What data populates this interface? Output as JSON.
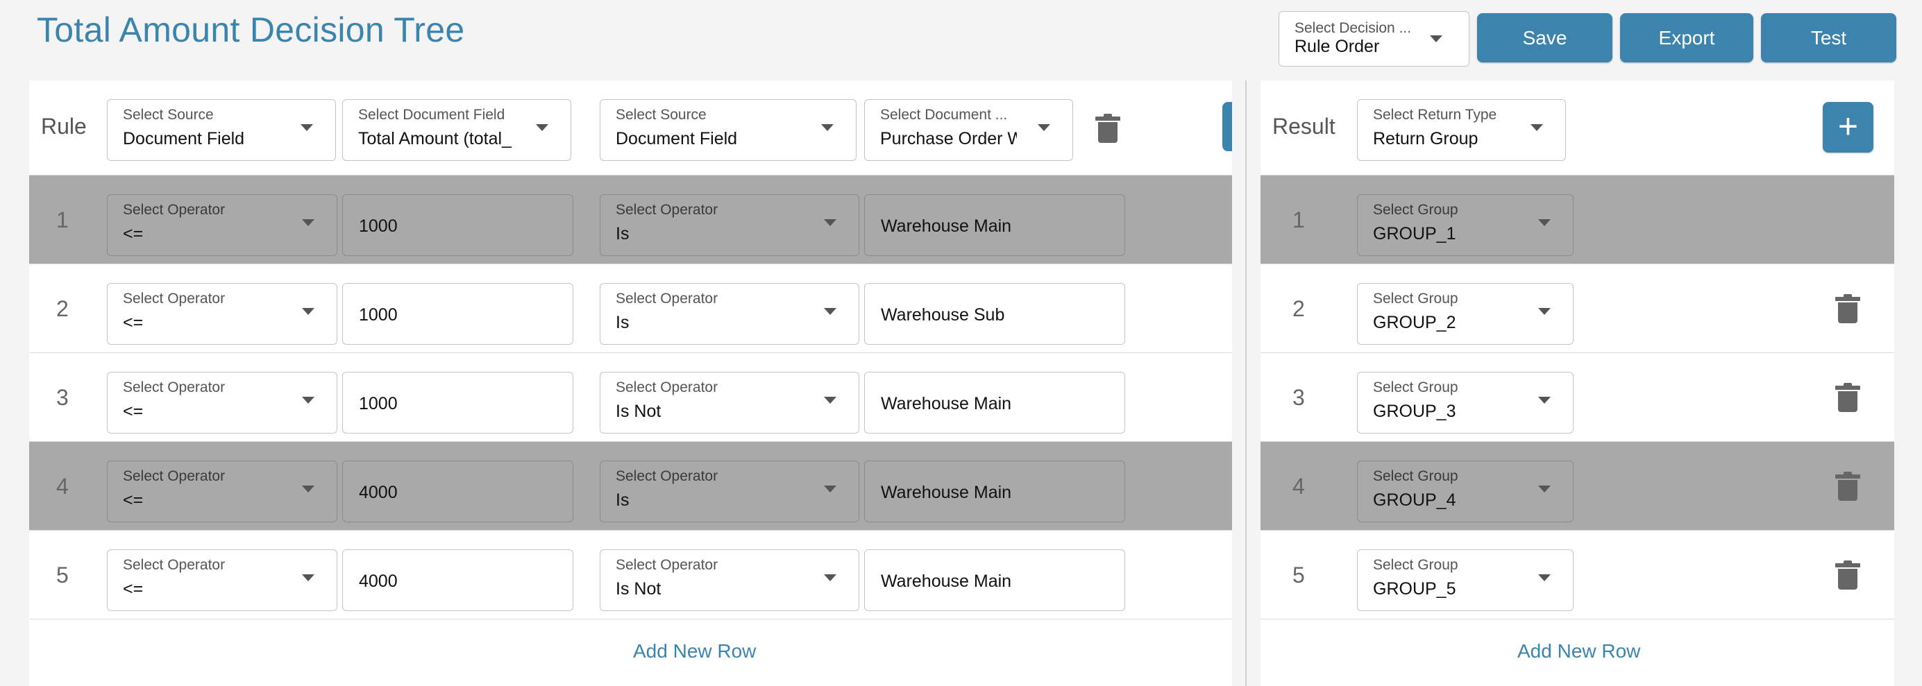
{
  "page": {
    "title": "Total Amount Decision Tree"
  },
  "toolbar": {
    "decision": {
      "label": "Select Decision ...",
      "value": "Rule Order"
    },
    "save": "Save",
    "export": "Export",
    "test": "Test"
  },
  "rule_panel": {
    "header_label": "Rule",
    "columns": [
      {
        "source_label": "Select Source",
        "source_value": "Document Field",
        "field_label": "Select Document Field",
        "field_value": "Total Amount (total_"
      },
      {
        "source_label": "Select Source",
        "source_value": "Document Field",
        "field_label": "Select Document ...",
        "field_value": "Purchase Order W"
      }
    ],
    "operator_label": "Select Operator",
    "rows": [
      {
        "num": "1",
        "op1": "<=",
        "val1": "1000",
        "op2": "Is",
        "val2": "Warehouse Main",
        "shaded": true
      },
      {
        "num": "2",
        "op1": "<=",
        "val1": "1000",
        "op2": "Is",
        "val2": "Warehouse Sub",
        "shaded": false
      },
      {
        "num": "3",
        "op1": "<=",
        "val1": "1000",
        "op2": "Is Not",
        "val2": "Warehouse Main",
        "shaded": false
      },
      {
        "num": "4",
        "op1": "<=",
        "val1": "4000",
        "op2": "Is",
        "val2": "Warehouse Main",
        "shaded": true
      },
      {
        "num": "5",
        "op1": "<=",
        "val1": "4000",
        "op2": "Is Not",
        "val2": "Warehouse Main",
        "shaded": false
      }
    ],
    "add_row": "Add New Row"
  },
  "result_panel": {
    "header_label": "Result",
    "return_type_label": "Select Return Type",
    "return_type_value": "Return Group",
    "group_label": "Select Group",
    "rows": [
      {
        "num": "1",
        "group": "GROUP_1",
        "shaded": true
      },
      {
        "num": "2",
        "group": "GROUP_2",
        "shaded": false
      },
      {
        "num": "3",
        "group": "GROUP_3",
        "shaded": false
      },
      {
        "num": "4",
        "group": "GROUP_4",
        "shaded": true
      },
      {
        "num": "5",
        "group": "GROUP_5",
        "shaded": false
      }
    ],
    "add_row": "Add New Row"
  },
  "icons": {
    "delete": "trash-icon",
    "add": "plus-icon",
    "dropdown": "caret-down-icon"
  },
  "colors": {
    "accent": "#3c84ad",
    "title": "#3a84ad",
    "shaded_row": "#a9a9a9"
  }
}
